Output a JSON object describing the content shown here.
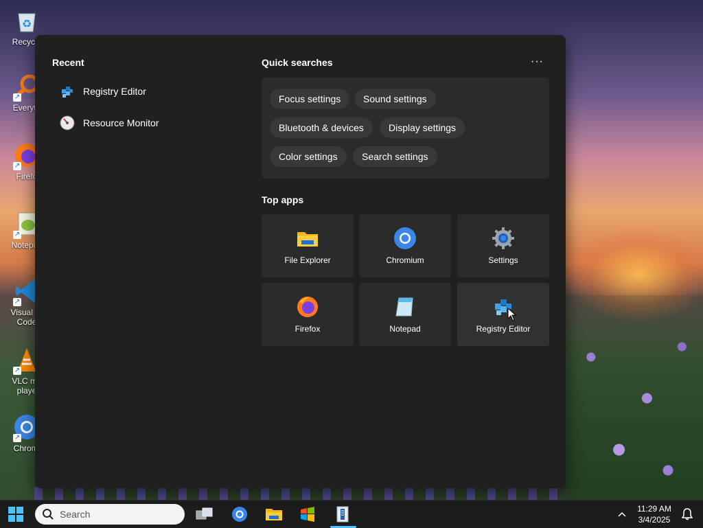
{
  "desktop": {
    "icons": [
      {
        "label": "Recycle",
        "icon": "recycle-bin-icon"
      },
      {
        "label": "Everyth",
        "icon": "everything-search-icon"
      },
      {
        "label": "Firefo",
        "icon": "firefox-icon"
      },
      {
        "label": "Notepac",
        "icon": "notepad-plus-icon"
      },
      {
        "label": "Visual St Code",
        "icon": "vscode-icon"
      },
      {
        "label": "VLC me playe",
        "icon": "vlc-icon"
      },
      {
        "label": "Chromi",
        "icon": "chromium-icon"
      }
    ]
  },
  "start": {
    "recent_title": "Recent",
    "recent": [
      {
        "label": "Registry Editor",
        "icon": "registry-editor-icon"
      },
      {
        "label": "Resource Monitor",
        "icon": "resource-monitor-icon"
      }
    ],
    "quick_title": "Quick searches",
    "more_label": "···",
    "quick": [
      "Focus settings",
      "Sound settings",
      "Bluetooth & devices",
      "Display settings",
      "Color settings",
      "Search settings"
    ],
    "top_apps_title": "Top apps",
    "apps": [
      {
        "label": "File Explorer",
        "icon": "folder-icon"
      },
      {
        "label": "Chromium",
        "icon": "chromium-icon"
      },
      {
        "label": "Settings",
        "icon": "gear-icon"
      },
      {
        "label": "Firefox",
        "icon": "firefox-icon"
      },
      {
        "label": "Notepad",
        "icon": "notepad-icon"
      },
      {
        "label": "Registry Editor",
        "icon": "registry-editor-icon"
      }
    ]
  },
  "taskbar": {
    "search_placeholder": "Search",
    "time": "11:29 AM",
    "date": "3/4/2025"
  }
}
